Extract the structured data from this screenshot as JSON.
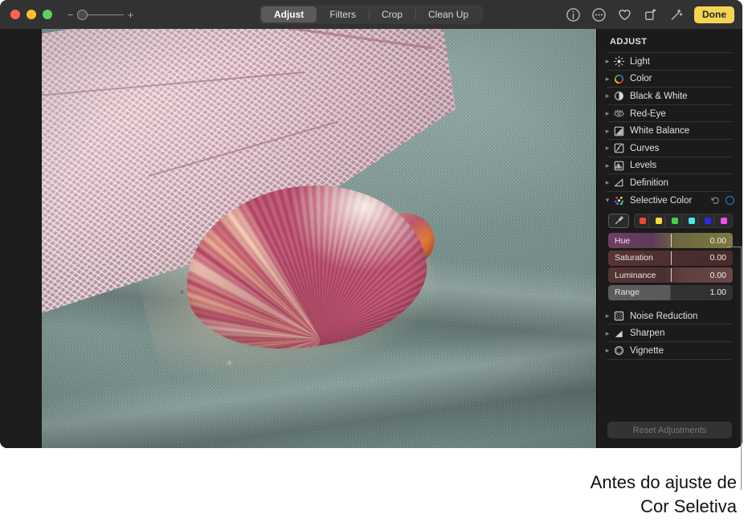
{
  "window": {
    "traffic_lights": [
      {
        "name": "close",
        "color": "#ff6159"
      },
      {
        "name": "minimize",
        "color": "#ffbd2e"
      },
      {
        "name": "maximize",
        "color": "#5fd05f"
      }
    ],
    "zoom_control": {
      "minus": "−",
      "plus": "+",
      "value": 0
    }
  },
  "toolbar": {
    "tabs": [
      {
        "label": "Adjust",
        "active": true
      },
      {
        "label": "Filters",
        "active": false
      },
      {
        "label": "Crop",
        "active": false
      },
      {
        "label": "Clean Up",
        "active": false
      }
    ],
    "right_icons": [
      {
        "name": "info-icon",
        "title": "Info"
      },
      {
        "name": "more-options-icon",
        "title": "More"
      },
      {
        "name": "favorite-heart-icon",
        "title": "Favorite"
      },
      {
        "name": "rotate-icon",
        "title": "Rotate"
      },
      {
        "name": "auto-enhance-wand-icon",
        "title": "Auto Enhance"
      }
    ],
    "done_label": "Done",
    "done_color": "#f4d552"
  },
  "sidebar": {
    "title": "ADJUST",
    "items": [
      {
        "label": "Light",
        "icon": "brightness-icon",
        "expanded": false
      },
      {
        "label": "Color",
        "icon": "color-wheel-icon",
        "expanded": false
      },
      {
        "label": "Black & White",
        "icon": "contrast-circle-icon",
        "expanded": false
      },
      {
        "label": "Red-Eye",
        "icon": "eye-slash-icon",
        "expanded": false
      },
      {
        "label": "White Balance",
        "icon": "white-balance-icon",
        "expanded": false
      },
      {
        "label": "Curves",
        "icon": "curves-icon",
        "expanded": false
      },
      {
        "label": "Levels",
        "icon": "levels-histogram-icon",
        "expanded": false
      },
      {
        "label": "Definition",
        "icon": "definition-triangle-icon",
        "expanded": false
      }
    ],
    "selective_color": {
      "label": "Selective Color",
      "expanded": true,
      "icon": "selective-color-dots-icon",
      "reset_icon": "undo-arrow-icon",
      "toggle_icon": "enable-ring-icon",
      "toggle_color": "#2f7fe0",
      "eyedropper_icon": "eyedropper-icon",
      "swatches": [
        {
          "name": "red",
          "color": "#f0452a"
        },
        {
          "name": "yellow",
          "color": "#f5e032"
        },
        {
          "name": "green",
          "color": "#46d146"
        },
        {
          "name": "cyan",
          "color": "#4fe8e8"
        },
        {
          "name": "blue",
          "color": "#2a2ae8"
        },
        {
          "name": "magenta",
          "color": "#ea52ea"
        }
      ],
      "sliders": [
        {
          "label": "Hue",
          "value": "0.00",
          "knob_pct": 50,
          "gradient": "linear-gradient(90deg, #6f3f63 0%, #5e3a58 35%, #6b6640 55%, #7c7a3f 100%)"
        },
        {
          "label": "Saturation",
          "value": "0.00",
          "knob_pct": 50,
          "gradient": "linear-gradient(90deg, #5a3434 0%, #4e3030 45%, #4a2e2e 55%, #472c2c 100%)"
        },
        {
          "label": "Luminance",
          "value": "0.00",
          "knob_pct": 50,
          "gradient": "linear-gradient(90deg, #553434 0%, #4b3030 45%, #5e3f3f 60%, #6b4646 100%)"
        },
        {
          "label": "Range",
          "value": "1.00",
          "knob_pct": 50,
          "gradient": "linear-gradient(90deg, #5c5c5c 0%, #5a5a5a 49.9%, #333333 50%, #303030 100%)"
        }
      ]
    },
    "items_after": [
      {
        "label": "Noise Reduction",
        "icon": "noise-reduction-icon",
        "expanded": false
      },
      {
        "label": "Sharpen",
        "icon": "sharpen-triangle-icon",
        "expanded": false
      },
      {
        "label": "Vignette",
        "icon": "vignette-circle-icon",
        "expanded": false
      }
    ],
    "reset_button": "Reset Adjustments"
  },
  "photo": {
    "alt": "Scallop shell with pink and coral ribs resting on a teal terry towel next to pink netting and sand",
    "colors": {
      "towel": "#7d9894",
      "net": "#c9a4b3",
      "shell": "#c45f6e",
      "sand": "#d8c8ac"
    }
  },
  "caption": {
    "line1": "Antes do ajuste de",
    "line2": "Cor Seletiva"
  }
}
